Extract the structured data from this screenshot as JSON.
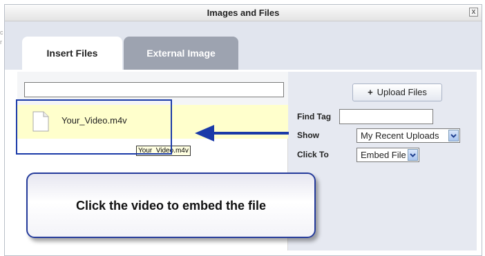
{
  "dialog": {
    "title": "Images and Files",
    "close_glyph": "x"
  },
  "tabs": [
    {
      "label": "Insert Files",
      "active": true
    },
    {
      "label": "External Image",
      "active": false
    }
  ],
  "search": {
    "value": "",
    "placeholder": ""
  },
  "files": [
    {
      "name": "Your_Video.m4v",
      "icon": "file-icon",
      "highlighted": true
    }
  ],
  "tooltip": {
    "text": "Your_Video.m4v"
  },
  "controls": {
    "upload_label": "Upload Files",
    "upload_icon": "+",
    "find_tag_label": "Find Tag",
    "find_tag_value": "",
    "show_label": "Show",
    "show_value": "My Recent Uploads",
    "click_to_label": "Click To",
    "click_to_value": "Embed File"
  },
  "annotation": {
    "callout_text": "Click the video to embed the file",
    "accent_color": "#1a3aa8"
  },
  "colors": {
    "highlight_row": "#ffffcc",
    "panel_bg": "#e6e9f1",
    "inactive_tab": "#9da3b0"
  }
}
